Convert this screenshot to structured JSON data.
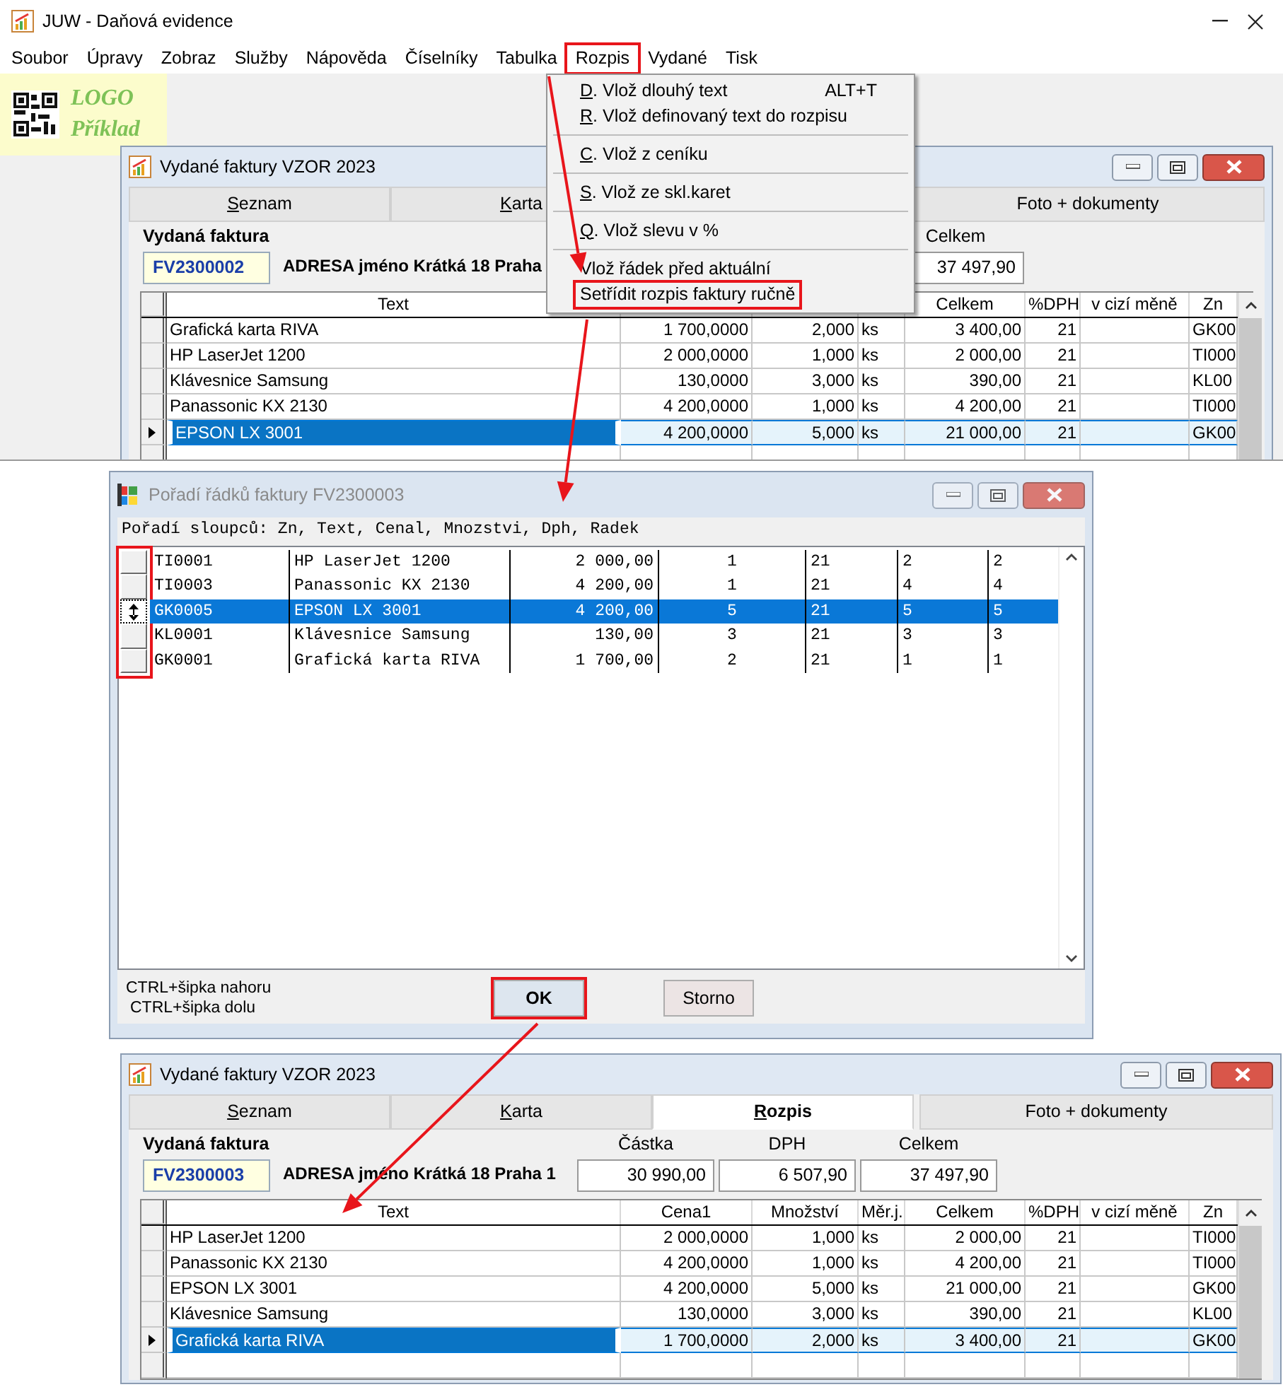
{
  "app": {
    "title": "JUW - Daňová evidence",
    "menu": [
      {
        "label": "Soubor",
        "highlighted": false
      },
      {
        "label": "Úpravy",
        "highlighted": false
      },
      {
        "label": "Zobraz",
        "highlighted": false
      },
      {
        "label": "Služby",
        "highlighted": false
      },
      {
        "label": "Nápověda",
        "highlighted": false
      },
      {
        "label": "Číselníky",
        "highlighted": false
      },
      {
        "label": "Tabulka",
        "highlighted": false
      },
      {
        "label": "Rozpis",
        "highlighted": true
      },
      {
        "label": "Vydané",
        "highlighted": false
      },
      {
        "label": "Tisk",
        "highlighted": false
      }
    ]
  },
  "logo": {
    "line_1": "LOGO",
    "line_2": "Příklad"
  },
  "menu_dropdown": [
    {
      "kind": "item",
      "text": "D. Vlož dlouhý text",
      "accelerator": true,
      "shortcut": "ALT+T",
      "highlighted": false
    },
    {
      "kind": "item",
      "text": "R. Vlož definovaný text do rozpisu",
      "accelerator": true,
      "highlighted": false
    },
    {
      "kind": "separator"
    },
    {
      "kind": "item",
      "text": "C. Vlož z ceníku",
      "accelerator": true,
      "highlighted": false
    },
    {
      "kind": "separator"
    },
    {
      "kind": "item",
      "text": "S. Vlož  ze skl.karet",
      "accelerator": true,
      "highlighted": false
    },
    {
      "kind": "separator"
    },
    {
      "kind": "item",
      "text": "Q. Vlož slevu v %",
      "accelerator": true,
      "highlighted": false
    },
    {
      "kind": "separator"
    },
    {
      "kind": "item",
      "text": "Vlož řádek před aktuální",
      "accelerator": false,
      "highlighted": false
    },
    {
      "kind": "item",
      "text": "Setřídit rozpis faktury ručně",
      "accelerator": false,
      "highlighted": true
    }
  ],
  "invoice_window_before": {
    "title": "Vydané faktury VZOR 2023",
    "tabs": [
      {
        "label": "Seznam",
        "accelerator": true,
        "selected": false
      },
      {
        "label": "Karta",
        "accelerator": true,
        "selected": false
      },
      {
        "label": "Foto + dokumenty",
        "accelerator": false,
        "selected": false
      }
    ],
    "heading": "Vydaná faktura",
    "number": "FV2300002",
    "address": "ADRESA jméno Krátká 18 Praha",
    "totals": [
      {
        "label": "Celkem",
        "value": "37 497,90"
      }
    ],
    "header": {
      "text": "Text",
      "celkem": "Celkem",
      "dph": "%DPH",
      "mena": "v cizí měně",
      "zn": "Zn"
    },
    "rows": [
      {
        "selected": false,
        "text": "Grafická karta RIVA",
        "cena1": "1 700,0000",
        "mnozstvi": "2,000",
        "merj": "ks",
        "celkem": "3 400,00",
        "dph": "21",
        "zn": "GK00"
      },
      {
        "selected": false,
        "text": "HP LaserJet 1200",
        "cena1": "2 000,0000",
        "mnozstvi": "1,000",
        "merj": "ks",
        "celkem": "2 000,00",
        "dph": "21",
        "zn": "TI000"
      },
      {
        "selected": false,
        "text": "Klávesnice Samsung",
        "cena1": "130,0000",
        "mnozstvi": "3,000",
        "merj": "ks",
        "celkem": "390,00",
        "dph": "21",
        "zn": "KL00"
      },
      {
        "selected": false,
        "text": "Panassonic KX 2130",
        "cena1": "4 200,0000",
        "mnozstvi": "1,000",
        "merj": "ks",
        "celkem": "4 200,00",
        "dph": "21",
        "zn": "TI000"
      },
      {
        "selected": true,
        "text": "EPSON LX 3001",
        "cena1": "4 200,0000",
        "mnozstvi": "5,000",
        "merj": "ks",
        "celkem": "21 000,00",
        "dph": "21",
        "zn": "GK00"
      }
    ]
  },
  "order_dialog": {
    "title": "Pořadí řádků faktury FV2300003",
    "caption": "Pořadí sloupců: Zn, Text, Cenal, Mnozstvi, Dph, Radek",
    "handles_highlighted": true,
    "rows": [
      {
        "selected": false,
        "cells": [
          "TI0001",
          "HP LaserJet 1200",
          "2 000,00",
          "1",
          "21",
          "2",
          "2"
        ]
      },
      {
        "selected": false,
        "cells": [
          "TI0003",
          "Panassonic KX 2130",
          "4 200,00",
          "1",
          "21",
          "4",
          "4"
        ]
      },
      {
        "selected": true,
        "cells": [
          "GK0005",
          "EPSON LX 3001",
          "4 200,00",
          "5",
          "21",
          "5",
          "5"
        ]
      },
      {
        "selected": false,
        "cells": [
          "KL0001",
          "Klávesnice Samsung",
          "130,00",
          "3",
          "21",
          "3",
          "3"
        ]
      },
      {
        "selected": false,
        "cells": [
          "GK0001",
          "Grafická karta RIVA",
          "1 700,00",
          "2",
          "21",
          "1",
          "1"
        ]
      }
    ],
    "hints": [
      "CTRL+šipka nahoru",
      "CTRL+šipka dolu"
    ],
    "buttons": [
      {
        "label": "OK",
        "kind": "default",
        "highlighted": true
      },
      {
        "label": "Storno",
        "kind": "cancel",
        "highlighted": false
      }
    ]
  },
  "invoice_window_after": {
    "title": "Vydané faktury VZOR 2023",
    "tabs": [
      {
        "label": "Seznam",
        "accelerator": true,
        "selected": false
      },
      {
        "label": "Karta",
        "accelerator": true,
        "selected": false
      },
      {
        "label": "Rozpis",
        "accelerator": true,
        "selected": true
      },
      {
        "label": "Foto + dokumenty",
        "accelerator": false,
        "selected": false
      }
    ],
    "heading": "Vydaná faktura",
    "number": "FV2300003",
    "address": "ADRESA jméno Krátká 18 Praha 1",
    "totals": [
      {
        "label": "Částka",
        "value": "30 990,00"
      },
      {
        "label": "DPH",
        "value": "6 507,90"
      },
      {
        "label": "Celkem",
        "value": "37 497,90"
      }
    ],
    "header": {
      "text": "Text",
      "cena1": "Cena1",
      "mnozstvi": "Množství",
      "merj": "Měr.j.",
      "celkem": "Celkem",
      "dph": "%DPH",
      "mena": "v cizí měně",
      "zn": "Zn"
    },
    "rows": [
      {
        "selected": false,
        "text": "HP LaserJet 1200",
        "cena1": "2 000,0000",
        "mnozstvi": "1,000",
        "merj": "ks",
        "celkem": "2 000,00",
        "dph": "21",
        "zn": "TI000"
      },
      {
        "selected": false,
        "text": "Panassonic KX 2130",
        "cena1": "4 200,0000",
        "mnozstvi": "1,000",
        "merj": "ks",
        "celkem": "4 200,00",
        "dph": "21",
        "zn": "TI000"
      },
      {
        "selected": false,
        "text": "EPSON LX 3001",
        "cena1": "4 200,0000",
        "mnozstvi": "5,000",
        "merj": "ks",
        "celkem": "21 000,00",
        "dph": "21",
        "zn": "GK00"
      },
      {
        "selected": false,
        "text": "Klávesnice Samsung",
        "cena1": "130,0000",
        "mnozstvi": "3,000",
        "merj": "ks",
        "celkem": "390,00",
        "dph": "21",
        "zn": "KL00"
      },
      {
        "selected": true,
        "text": "Grafická karta RIVA",
        "cena1": "1 700,0000",
        "mnozstvi": "2,000",
        "merj": "ks",
        "celkem": "3 400,00",
        "dph": "21",
        "zn": "GK00"
      }
    ]
  }
}
